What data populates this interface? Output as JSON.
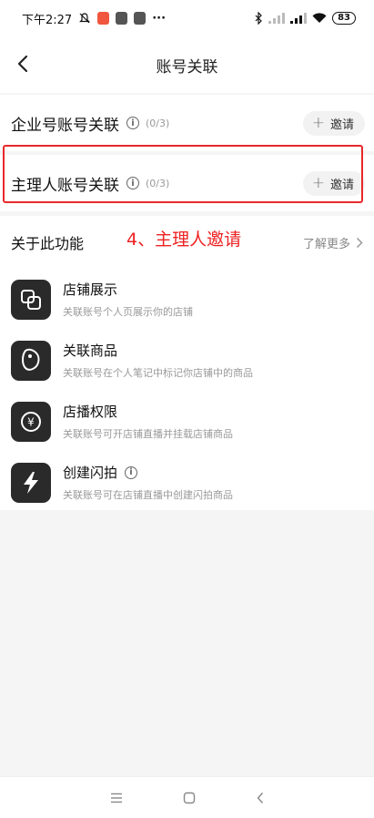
{
  "status_bar": {
    "time": "下午2:27",
    "dots": "···",
    "battery": "83"
  },
  "header": {
    "title": "账号关联"
  },
  "sections": [
    {
      "title": "企业号账号关联",
      "count": "(0/3)",
      "invite_label": "邀请"
    },
    {
      "title": "主理人账号关联",
      "count": "(0/3)",
      "invite_label": "邀请"
    }
  ],
  "annotation": {
    "text": "4、主理人邀请",
    "color": "#e8282b"
  },
  "features": {
    "title": "关于此功能",
    "more_label": "了解更多",
    "items": [
      {
        "icon": "overlap-squares-icon",
        "title": "店铺展示",
        "desc": "关联账号个人页展示你的店铺"
      },
      {
        "icon": "tag-icon",
        "title": "关联商品",
        "desc": "关联账号在个人笔记中标记你店铺中的商品"
      },
      {
        "icon": "yen-coin-icon",
        "title": "店播权限",
        "desc": "关联账号可开店铺直播并挂载店铺商品"
      },
      {
        "icon": "lightning-icon",
        "title": "创建闪拍",
        "desc": "关联账号可在店铺直播中创建闪拍商品"
      }
    ]
  },
  "nav_bar": {
    "menu": "menu-icon",
    "home": "home-icon",
    "back": "back-icon"
  }
}
